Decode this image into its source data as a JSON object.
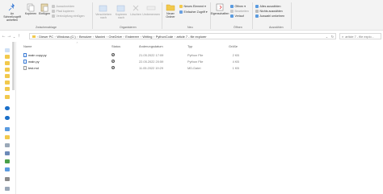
{
  "ribbon": {
    "pin_quick_access": "An Schnellzugriff anheften",
    "copy": "Kopieren",
    "paste": "Einfügen",
    "cut": "Ausschneiden",
    "copy_path": "Pfad kopieren",
    "paste_shortcut": "Verknüpfung einfügen",
    "move_to": "Verschieben nach",
    "copy_to": "Kopieren nach",
    "delete": "Löschen",
    "rename": "Umbenennen",
    "new_folder": "Neuer Ordner",
    "new_item": "Neues Element",
    "easy_access": "Einfacher Zugriff",
    "properties": "Eigenschaften",
    "open": "Öffnen",
    "edit": "Bearbeiten",
    "history": "Verlauf",
    "select_all": "Alles auswählen",
    "select_none": "Nichts auswählen",
    "invert_selection": "Auswahl umkehren",
    "group_clipboard": "Zwischenablage",
    "group_organize": "Organisieren",
    "group_new": "Neu",
    "group_open": "Öffnen",
    "group_select": "Auswählen"
  },
  "address": {
    "crumbs": [
      "Dieser PC",
      "Windows (C:)",
      "Benutzer",
      "Maximi",
      "OneDrive",
      "Endeeeer",
      "Writing",
      "PythonCode",
      "article 7 - file explorer"
    ],
    "search_placeholder": "article 7 - file explo..."
  },
  "columns": {
    "name": "Name",
    "status": "Status",
    "date": "Änderungsdatum",
    "type": "Typ",
    "size": "Größe"
  },
  "files": [
    {
      "name": "main copy.py",
      "date": "21.05.2022 17:09",
      "type": "Python File",
      "size": "2 KB",
      "icon": "python-file-icon"
    },
    {
      "name": "main.py",
      "date": "22.05.2022 20:59",
      "type": "Python File",
      "size": "4 KB",
      "icon": "python-file-icon"
    },
    {
      "name": "test.md",
      "date": "11.05.2022 19:29",
      "type": "MD-Datei",
      "size": "1 KB",
      "icon": "md-file-icon"
    }
  ],
  "colors": {
    "accent": "#1e73d6",
    "ribbon_bg": "#f3f3f3",
    "onedrive": "#1a6fc9"
  }
}
